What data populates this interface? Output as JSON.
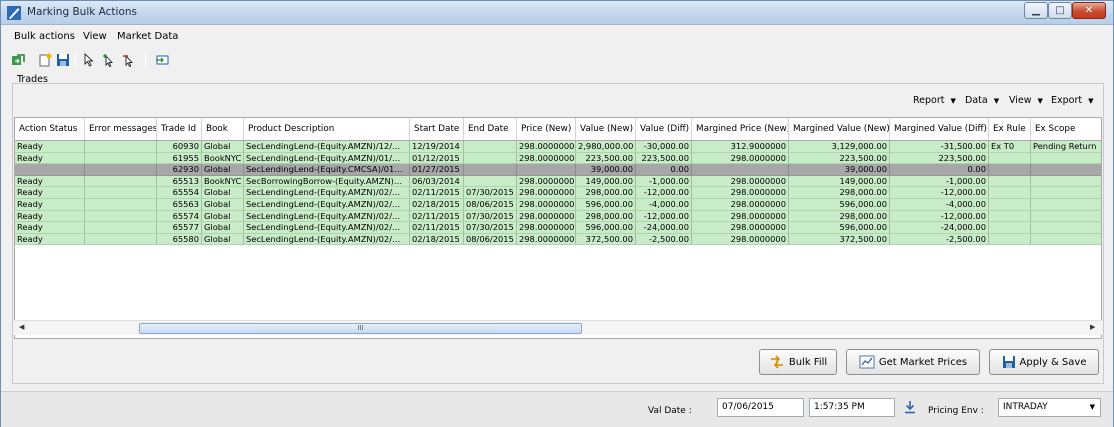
{
  "window": {
    "title": "Marking Bulk Actions"
  },
  "menu": [
    "Bulk actions",
    "View",
    "Market Data"
  ],
  "trades_label": "Trades",
  "grid_menu": [
    "Report",
    "Data",
    "View",
    "Export"
  ],
  "columns": [
    "Action Status",
    "Error messages",
    "Trade Id",
    "Book",
    "Product Description",
    "Start Date",
    "End Date",
    "Price (New)",
    "Value (New)",
    "Value (Diff)",
    "Margined Price (New)",
    "Margined Value (New)",
    "Margined Value (Diff)",
    "Ex Rule",
    "Ex Scope"
  ],
  "rows": [
    {
      "status": "green",
      "cells": [
        "Ready",
        "",
        "60930",
        "Global",
        "SecLendingLend-(Equity.AMZN)/12/…",
        "12/19/2014",
        "",
        "298.0000000",
        "2,980,000.00",
        "-30,000.00",
        "312.9000000",
        "3,129,000.00",
        "-31,500.00",
        "Ex T0",
        "Pending Return"
      ]
    },
    {
      "status": "green",
      "cells": [
        "Ready",
        "",
        "61955",
        "BookNYC",
        "SecLendingLend-(Equity.AMZN)/01/…",
        "01/12/2015",
        "",
        "298.0000000",
        "223,500.00",
        "223,500.00",
        "298.0000000",
        "223,500.00",
        "223,500.00",
        "",
        ""
      ]
    },
    {
      "status": "gray",
      "cells": [
        "",
        "",
        "62930",
        "Global",
        "SecLendingLend-(Equity.CMCSA)/01…",
        "01/27/2015",
        "",
        "",
        "39,000.00",
        "0.00",
        "",
        "39,000.00",
        "0.00",
        "",
        ""
      ]
    },
    {
      "status": "green",
      "cells": [
        "Ready",
        "",
        "65513",
        "BookNYC",
        "SecBorrowingBorrow-(Equity.AMZN)…",
        "06/03/2014",
        "",
        "298.0000000",
        "149,000.00",
        "-1,000.00",
        "298.0000000",
        "149,000.00",
        "-1,000.00",
        "",
        ""
      ]
    },
    {
      "status": "green",
      "cells": [
        "Ready",
        "",
        "65554",
        "Global",
        "SecLendingLend-(Equity.AMZN)/02/…",
        "02/11/2015",
        "07/30/2015",
        "298.0000000",
        "298,000.00",
        "-12,000.00",
        "298.0000000",
        "298,000.00",
        "-12,000.00",
        "",
        ""
      ]
    },
    {
      "status": "green",
      "cells": [
        "Ready",
        "",
        "65563",
        "Global",
        "SecLendingLend-(Equity.AMZN)/02/…",
        "02/18/2015",
        "08/06/2015",
        "298.0000000",
        "596,000.00",
        "-4,000.00",
        "298.0000000",
        "596,000.00",
        "-4,000.00",
        "",
        ""
      ]
    },
    {
      "status": "green",
      "cells": [
        "Ready",
        "",
        "65574",
        "Global",
        "SecLendingLend-(Equity.AMZN)/02/…",
        "02/11/2015",
        "07/30/2015",
        "298.0000000",
        "298,000.00",
        "-12,000.00",
        "298.0000000",
        "298,000.00",
        "-12,000.00",
        "",
        ""
      ]
    },
    {
      "status": "green",
      "cells": [
        "Ready",
        "",
        "65577",
        "Global",
        "SecLendingLend-(Equity.AMZN)/02/…",
        "02/11/2015",
        "07/30/2015",
        "298.0000000",
        "596,000.00",
        "-24,000.00",
        "298.0000000",
        "596,000.00",
        "-24,000.00",
        "",
        ""
      ]
    },
    {
      "status": "green",
      "cells": [
        "Ready",
        "",
        "65580",
        "Global",
        "SecLendingLend-(Equity.AMZN)/02/…",
        "02/18/2015",
        "08/06/2015",
        "298.0000000",
        "372,500.00",
        "-2,500.00",
        "298.0000000",
        "372,500.00",
        "-2,500.00",
        "",
        ""
      ]
    }
  ],
  "scrollbar": {
    "thumb_grip": "III"
  },
  "buttons": {
    "bulk_fill": "Bulk Fill",
    "get_market_prices": "Get Market Prices",
    "apply_save": "Apply & Save"
  },
  "status": {
    "val_date_label": "Val Date :",
    "val_date": "07/06/2015",
    "time": "1:57:35 PM",
    "pricing_env_label": "Pricing Env :",
    "pricing_env": "INTRADAY"
  },
  "colors": {
    "row_green": "#c8ebc8",
    "row_gray": "#a7a7a7",
    "accent": "#1f5fa8"
  }
}
